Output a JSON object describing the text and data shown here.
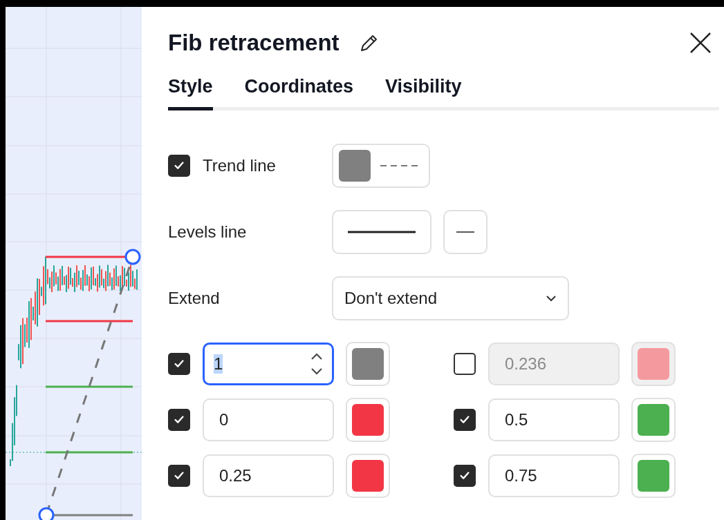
{
  "dialog": {
    "title": "Fib retracement"
  },
  "tabs": [
    {
      "label": "Style",
      "selected": true
    },
    {
      "label": "Coordinates",
      "selected": false
    },
    {
      "label": "Visibility",
      "selected": false
    }
  ],
  "trend_line": {
    "label": "Trend line",
    "checked": true
  },
  "levels_line": {
    "label": "Levels line"
  },
  "extend": {
    "label": "Extend",
    "value": "Don't extend"
  },
  "levels": [
    {
      "value": "1",
      "checked": true,
      "focused": true,
      "color": "#808080"
    },
    {
      "value": "0.236",
      "checked": false,
      "focused": false,
      "color": "#f49a9f"
    },
    {
      "value": "0",
      "checked": true,
      "focused": false,
      "color": "#f23645"
    },
    {
      "value": "0.5",
      "checked": true,
      "focused": false,
      "color": "#4caf50"
    },
    {
      "value": "0.25",
      "checked": true,
      "focused": false,
      "color": "#f23645"
    },
    {
      "value": "0.75",
      "checked": true,
      "focused": false,
      "color": "#4caf50"
    }
  ]
}
